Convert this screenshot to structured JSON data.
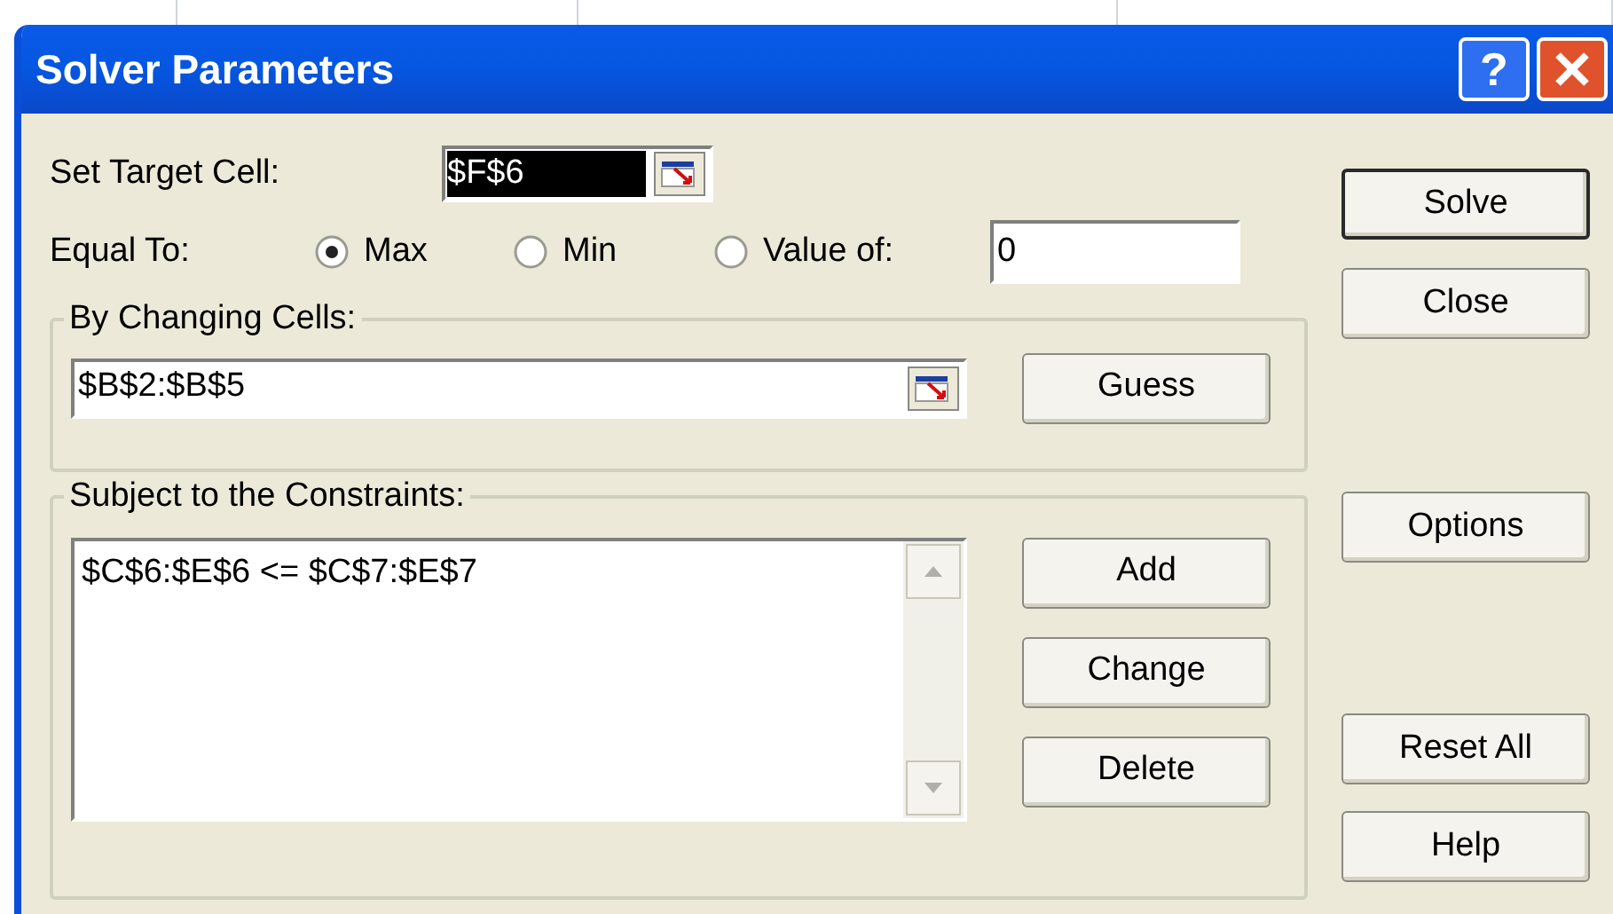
{
  "window": {
    "title": "Solver Parameters",
    "help_button": "?"
  },
  "target": {
    "label": "Set Target Cell:",
    "value": "$F$6",
    "selected": true
  },
  "equal_to": {
    "label": "Equal To:",
    "options": [
      {
        "label": "Max",
        "selected": true
      },
      {
        "label": "Min",
        "selected": false
      },
      {
        "label": "Value of:",
        "selected": false
      }
    ],
    "value": "0"
  },
  "changing_cells": {
    "label": "By Changing Cells:",
    "value": "$B$2:$B$5",
    "button": {
      "label": "Guess"
    }
  },
  "constraints": {
    "label": "Subject to the Constraints:",
    "items": [
      "$C$6:$E$6 <= $C$7:$E$7"
    ],
    "buttons": [
      {
        "label": "Add"
      },
      {
        "label": "Change"
      },
      {
        "label": "Delete"
      }
    ]
  },
  "side_buttons": [
    {
      "label": "Solve",
      "default": true
    },
    {
      "label": "Close",
      "default": false
    },
    {
      "label": "Options",
      "default": false
    },
    {
      "label": "Reset All",
      "default": false
    },
    {
      "label": "Help",
      "default": false
    }
  ]
}
